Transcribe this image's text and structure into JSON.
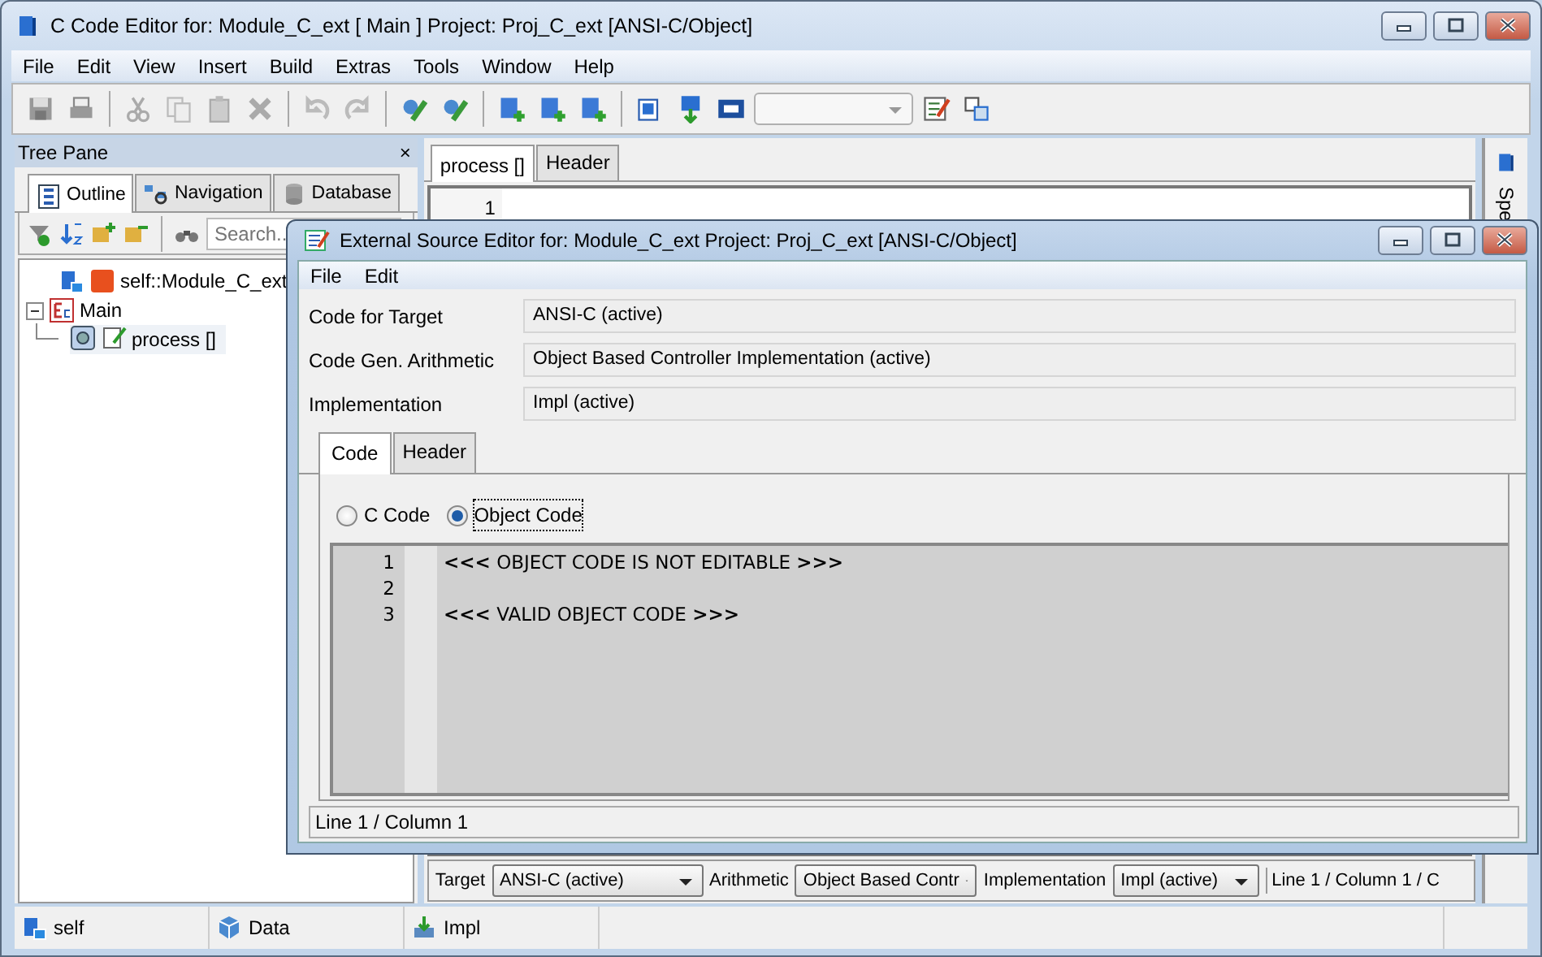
{
  "main_window": {
    "title": "C Code Editor for: Module_C_ext [ Main ] Project: Proj_C_ext [ANSI-C/Object]",
    "menu": [
      "File",
      "Edit",
      "View",
      "Insert",
      "Build",
      "Extras",
      "Tools",
      "Window",
      "Help"
    ]
  },
  "tree_pane": {
    "title": "Tree Pane",
    "close": "×",
    "tabs": [
      {
        "label": "Outline",
        "selected": true
      },
      {
        "label": "Navigation",
        "selected": false
      },
      {
        "label": "Database",
        "selected": false
      }
    ],
    "search": {
      "placeholder": "Search.."
    },
    "tree": [
      {
        "label": "self::Module_C_ext"
      },
      {
        "label": "Main",
        "expanded": true,
        "children": [
          {
            "label": "process []"
          }
        ]
      }
    ]
  },
  "editor": {
    "tabs": [
      {
        "label": "process []",
        "selected": true
      },
      {
        "label": "Header",
        "selected": false
      }
    ],
    "line_numbers": [
      "1"
    ],
    "side_tab": "Spe",
    "bottom_bar": {
      "fields": [
        {
          "label": "Target",
          "value": "ANSI-C (active)"
        },
        {
          "label": "Arithmetic",
          "value": "Object Based Contr"
        },
        {
          "label": "Implementation",
          "value": "Impl (active)"
        }
      ],
      "position": "Line 1 / Column 1 / C"
    }
  },
  "status_bar": [
    "self",
    "Data",
    "Impl"
  ],
  "dialog": {
    "title": "External Source Editor for: Module_C_ext Project: Proj_C_ext [ANSI-C/Object]",
    "menu": [
      "File",
      "Edit"
    ],
    "fields": [
      {
        "label": "Code for Target",
        "value": "ANSI-C (active)"
      },
      {
        "label": "Code Gen. Arithmetic",
        "value": "Object Based Controller Implementation (active)"
      },
      {
        "label": "Implementation",
        "value": "Impl (active)"
      }
    ],
    "tabs": [
      {
        "label": "Code",
        "selected": true
      },
      {
        "label": "Header",
        "selected": false
      }
    ],
    "radios": [
      {
        "label": "C Code",
        "selected": false
      },
      {
        "label": "Object Code",
        "selected": true
      }
    ],
    "code_lines": [
      {
        "number": "1",
        "text": "**<<<** OBJECT CODE IS NOT EDITABLE **>>>**"
      },
      {
        "number": "2"
      },
      {
        "number": "3",
        "text": "**<<<** VALID OBJECT CODE **>>>**"
      }
    ],
    "status": "Line 1 / Column 1"
  }
}
